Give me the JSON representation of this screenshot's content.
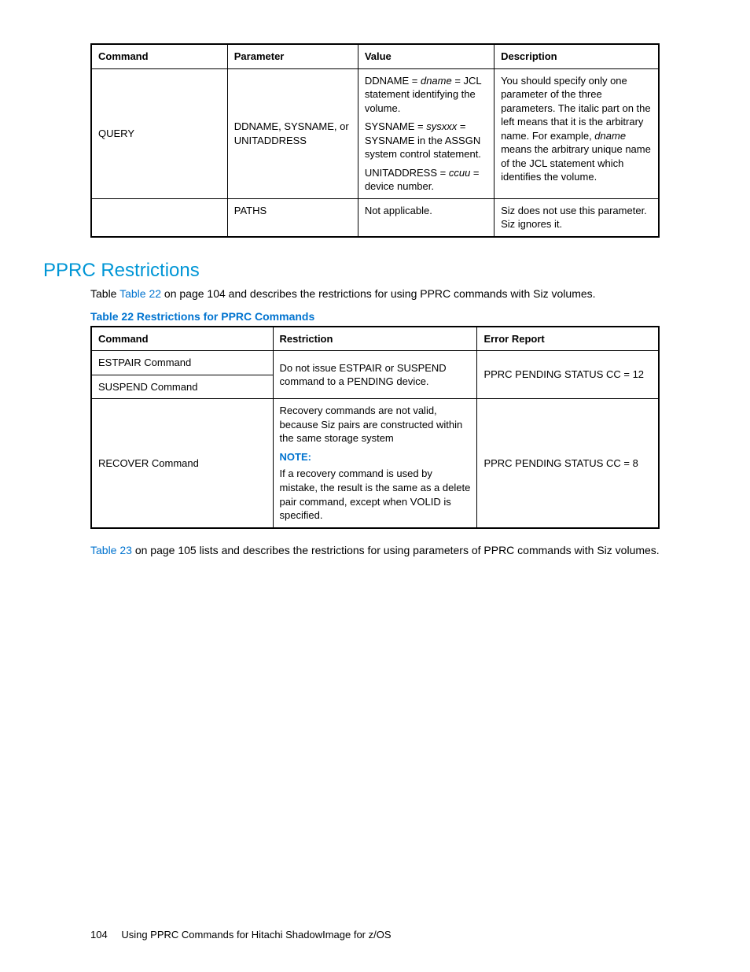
{
  "table1": {
    "headers": [
      "Command",
      "Parameter",
      "Value",
      "Description"
    ],
    "rows": [
      {
        "command": "QUERY",
        "parameter": "DDNAME, SYSNAME, or UNITADDRESS",
        "value_parts": {
          "a1": "DDNAME = ",
          "a2_i": "dname",
          "a3": " = JCL statement identifying the volume.",
          "b1": "SYSNAME = ",
          "b2_i": "sysxxx",
          "b3": " = SYSNAME in the ASSGN system control statement.",
          "c1": "UNITADDRESS = ",
          "c2_i": "ccuu",
          "c3": " = device number."
        },
        "description_parts": {
          "p1": "You should specify only one parameter of the three parameters.  The italic part on the left means that it is the arbitrary name.  For example, ",
          "p2_i": "dname",
          "p3": " means the arbitrary unique name of the JCL statement which identifies the volume."
        }
      },
      {
        "command": "",
        "parameter": "PATHS",
        "value": "Not applicable.",
        "description": "Siz does not use this parameter. Siz ignores it."
      }
    ]
  },
  "section_heading": "PPRC Restrictions",
  "intro_para": {
    "pre": "Table ",
    "link": "Table 22",
    "post": " on page 104 and describes the restrictions for using PPRC commands with Siz volumes."
  },
  "table2_caption": "Table 22 Restrictions for PPRC Commands",
  "table2": {
    "headers": [
      "Command",
      "Restriction",
      "Error Report"
    ],
    "rows": {
      "r1_command": "ESTPAIR Command",
      "r2_command": "SUSPEND Command",
      "r12_restriction": "Do not issue ESTPAIR or SUSPEND command to a PENDING device.",
      "r12_error": "PPRC PENDING STATUS CC = 12",
      "r3_command": "RECOVER Command",
      "r3_restriction_pre": "Recovery commands are not valid, because Siz pairs are constructed within the same storage system",
      "r3_note_label": "NOTE:",
      "r3_restriction_post": "If a recovery command is used by mistake, the result is the same as a delete pair command, except when VOLID is specified.",
      "r3_error": "PPRC PENDING STATUS CC = 8"
    }
  },
  "outro_para": {
    "link": "Table 23",
    "post": " on page 105 lists and describes the restrictions for using parameters of PPRC commands with Siz volumes."
  },
  "footer": {
    "page": "104",
    "title": "Using PPRC Commands for Hitachi ShadowImage for z/OS"
  }
}
